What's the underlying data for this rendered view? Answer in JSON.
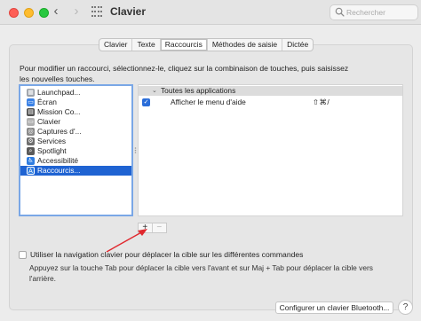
{
  "window": {
    "title": "Clavier",
    "search_placeholder": "Rechercher",
    "back_glyph": "‹",
    "forward_glyph": "›"
  },
  "tabs": [
    {
      "label": "Clavier",
      "active": false
    },
    {
      "label": "Texte",
      "active": false
    },
    {
      "label": "Raccourcis",
      "active": true
    },
    {
      "label": "Méthodes de saisie",
      "active": false
    },
    {
      "label": "Dictée",
      "active": false
    }
  ],
  "intro_text": "Pour modifier un raccourci, sélectionnez-le, cliquez sur la combinaison de touches, puis saisissez les nouvelles touches.",
  "categories": [
    {
      "label": "Launchpad...",
      "icon": "launchpad-icon",
      "color": "#9aa0a8",
      "glyph": "▦",
      "selected": false
    },
    {
      "label": "Écran",
      "icon": "display-icon",
      "color": "#3b82e6",
      "glyph": "▭",
      "selected": false
    },
    {
      "label": "Mission Co...",
      "icon": "mission-control-icon",
      "color": "#4f4f4f",
      "glyph": "▤",
      "selected": false
    },
    {
      "label": "Clavier",
      "icon": "keyboard-icon",
      "color": "#b0b0b0",
      "glyph": "▭",
      "selected": false
    },
    {
      "label": "Captures d'...",
      "icon": "screenshot-icon",
      "color": "#8a8a8a",
      "glyph": "◎",
      "selected": false
    },
    {
      "label": "Services",
      "icon": "gear-icon",
      "color": "#6e6e6e",
      "glyph": "⚙",
      "selected": false
    },
    {
      "label": "Spotlight",
      "icon": "spotlight-icon",
      "color": "#5a5a5a",
      "glyph": "⌕",
      "selected": false
    },
    {
      "label": "Accessibilité",
      "icon": "accessibility-icon",
      "color": "#2f7de1",
      "glyph": "♿",
      "selected": false
    },
    {
      "label": "Raccourcis...",
      "icon": "app-shortcuts-icon",
      "color": "#2f7de1",
      "glyph": "A",
      "selected": true
    }
  ],
  "shortcut_group": {
    "label": "Toutes les applications",
    "items": [
      {
        "label": "Afficher le menu d'aide",
        "keys": "⇧⌘/",
        "enabled": true
      }
    ]
  },
  "add_remove": {
    "plus": "+",
    "minus": "−"
  },
  "keyboard_navigation": {
    "label": "Utiliser la navigation clavier pour déplacer la cible sur les différentes commandes",
    "checked": false,
    "help": "Appuyez sur la touche Tab pour déplacer la cible vers l'avant et sur Maj + Tab pour déplacer la cible vers l'arrière."
  },
  "bluetooth_button": "Configurer un clavier Bluetooth...",
  "help_button": "?",
  "colors": {
    "selection": "#1f63d2",
    "annotation_arrow": "#e0282e"
  }
}
